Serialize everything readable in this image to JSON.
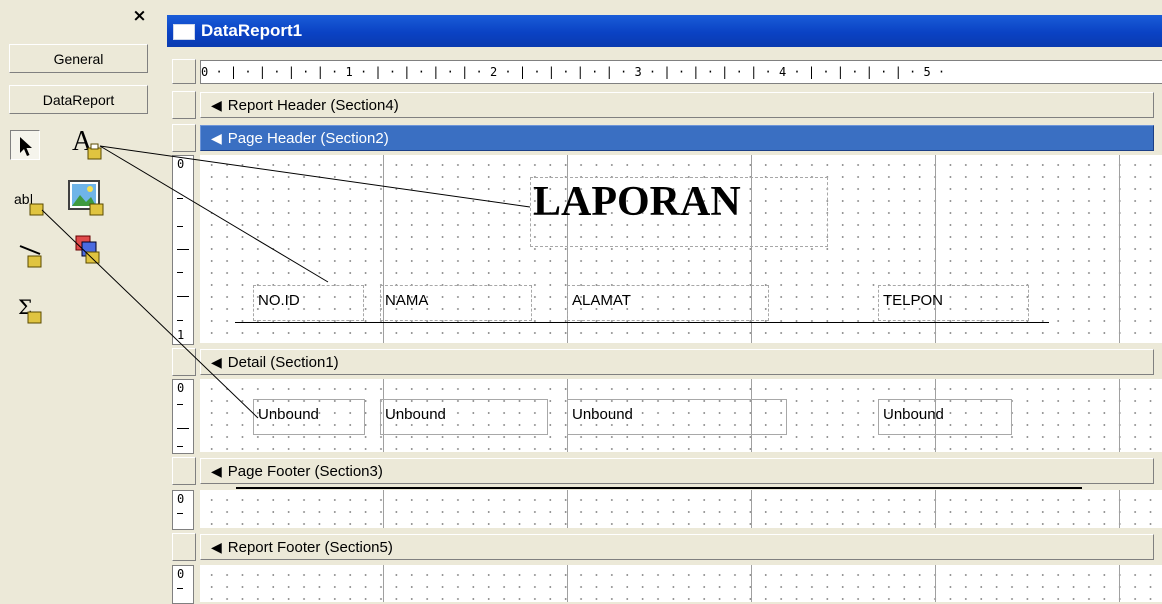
{
  "toolbox": {
    "close_glyph": "×",
    "tabs": [
      "General",
      "DataReport"
    ],
    "tools": [
      "pointer-icon",
      "label-tool-icon",
      "textbox-tool-icon",
      "image-tool-icon",
      "line-tool-icon",
      "shape-tool-icon",
      "function-tool-icon"
    ]
  },
  "window": {
    "title": "DataReport1"
  },
  "ruler": {
    "text": "0 · | · | · | · | · 1 · | · | · | · | · 2 · | · | · | · | · 3 · | · | · | · | · 4 · | · | · | · | · 5 ·"
  },
  "sections": {
    "report_header": "Report Header (Section4)",
    "page_header": "Page Header (Section2)",
    "detail": "Detail (Section1)",
    "page_footer": "Page Footer (Section3)",
    "report_footer": "Report Footer (Section5)"
  },
  "section_arrow": "◀",
  "vruler_labels": {
    "zero": "0",
    "one": "1"
  },
  "page_header": {
    "title": "LAPORAN",
    "columns": [
      "NO.ID",
      "NAMA",
      "ALAMAT",
      "TELPON"
    ]
  },
  "detail": {
    "fields": [
      "Unbound",
      "Unbound",
      "Unbound",
      "Unbound"
    ]
  },
  "colors": {
    "titlebar": "#0a42c4",
    "selected_section": "#3a6fc2",
    "toolbox": "#ece9d8"
  }
}
